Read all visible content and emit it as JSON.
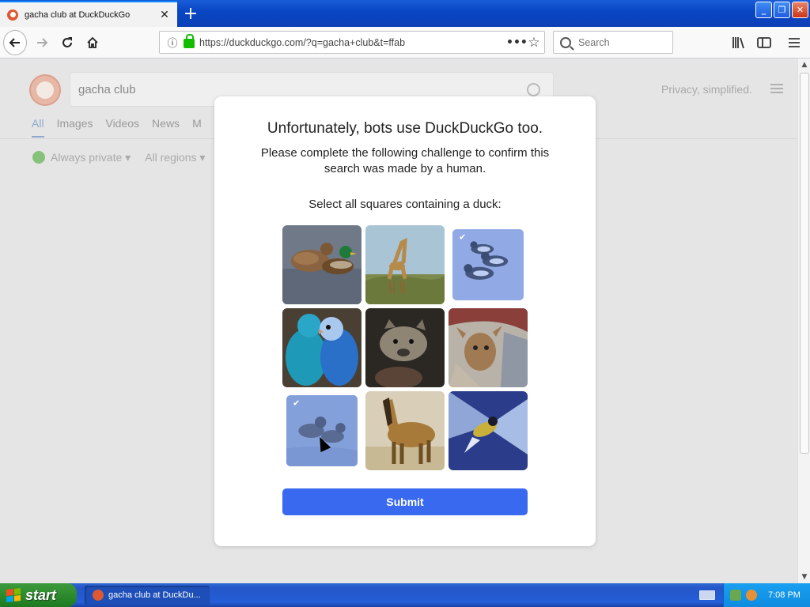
{
  "browser": {
    "tab_title": "gacha club at DuckDuckGo",
    "tab_close": "✕",
    "new_tab": "+",
    "window_buttons": {
      "minimize": "_",
      "maximize": "❐",
      "close": "✕"
    },
    "url": "https://duckduckgo.com/?q=gacha+club&t=ffab",
    "search_placeholder": "Search"
  },
  "page": {
    "query": "gacha club",
    "tagline": "Privacy, simplified.",
    "tabs": [
      "All",
      "Images",
      "Videos",
      "News",
      "M"
    ],
    "filters": {
      "privacy": "Always private ▾",
      "regions": "All regions ▾"
    }
  },
  "modal": {
    "title": "Unfortunately, bots use DuckDuckGo too.",
    "subtitle": "Please complete the following challenge to confirm this search was made by a human.",
    "prompt": "Select all squares containing a duck:",
    "submit_label": "Submit",
    "tiles": [
      {
        "name": "tile-mallard-ducks",
        "subject": "duck",
        "selected": false
      },
      {
        "name": "tile-giraffe",
        "subject": "giraffe",
        "selected": false
      },
      {
        "name": "tile-ducks-water",
        "subject": "duck",
        "selected": true
      },
      {
        "name": "tile-budgies",
        "subject": "parakeet",
        "selected": false
      },
      {
        "name": "tile-hyena",
        "subject": "hyena",
        "selected": false
      },
      {
        "name": "tile-deer",
        "subject": "deer",
        "selected": false
      },
      {
        "name": "tile-ducklings",
        "subject": "duck",
        "selected": true
      },
      {
        "name": "tile-horse",
        "subject": "horse",
        "selected": false
      },
      {
        "name": "tile-bird-flight",
        "subject": "bird",
        "selected": false
      }
    ]
  },
  "taskbar": {
    "start_label": "start",
    "task_item": "gacha club at DuckDu...",
    "clock": "7:08 PM"
  },
  "colors": {
    "accent": "#3969ef",
    "tab_highlight": "#0a84ff",
    "lock_green": "#12bc00",
    "ddg_orange": "#de5833"
  }
}
